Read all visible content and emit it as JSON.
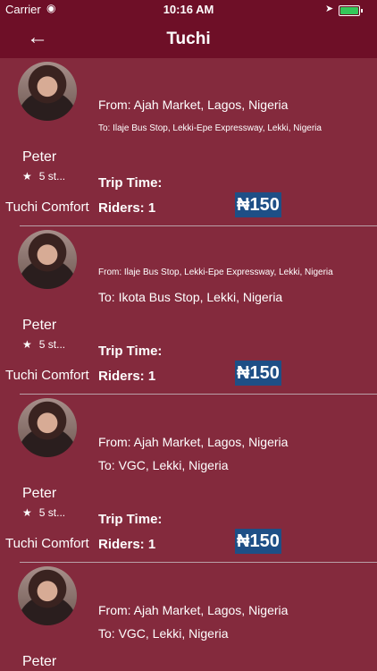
{
  "status_bar": {
    "carrier": "Carrier",
    "time": "10:16 AM"
  },
  "header": {
    "title": "Tuchi"
  },
  "trips": [
    {
      "driver": "Peter",
      "rating": "5 st...",
      "category": "Tuchi Comfort",
      "from": "From: Ajah Market, Lagos, Nigeria",
      "to": "To: Ilaje Bus Stop, Lekki-Epe Expressway, Lekki, Nigeria",
      "trip_time": "Trip Time:",
      "riders": "Riders: 1",
      "price": "₦150"
    },
    {
      "driver": "Peter",
      "rating": "5 st...",
      "category": "Tuchi Comfort",
      "from": "From: Ilaje Bus Stop, Lekki-Epe Expressway, Lekki, Nigeria",
      "to": "To: Ikota Bus Stop, Lekki, Nigeria",
      "trip_time": "Trip Time:",
      "riders": "Riders: 1",
      "price": "₦150"
    },
    {
      "driver": "Peter",
      "rating": "5 st...",
      "category": "Tuchi Comfort",
      "from": "From: Ajah Market, Lagos, Nigeria",
      "to": "To: VGC, Lekki, Nigeria",
      "trip_time": "Trip Time:",
      "riders": "Riders: 1",
      "price": "₦150"
    },
    {
      "driver": "Peter",
      "from": "From: Ajah Market, Lagos, Nigeria",
      "to": "To: VGC, Lekki, Nigeria"
    }
  ]
}
